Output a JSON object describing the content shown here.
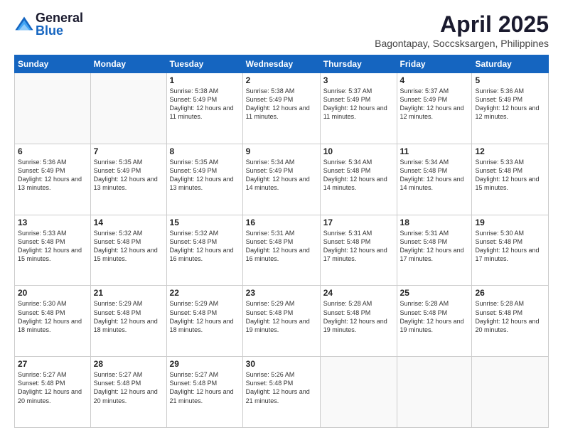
{
  "logo": {
    "general": "General",
    "blue": "Blue"
  },
  "title": "April 2025",
  "subtitle": "Bagontapay, Soccsksargen, Philippines",
  "days_of_week": [
    "Sunday",
    "Monday",
    "Tuesday",
    "Wednesday",
    "Thursday",
    "Friday",
    "Saturday"
  ],
  "weeks": [
    [
      {
        "day": "",
        "info": ""
      },
      {
        "day": "",
        "info": ""
      },
      {
        "day": "1",
        "info": "Sunrise: 5:38 AM\nSunset: 5:49 PM\nDaylight: 12 hours and 11 minutes."
      },
      {
        "day": "2",
        "info": "Sunrise: 5:38 AM\nSunset: 5:49 PM\nDaylight: 12 hours and 11 minutes."
      },
      {
        "day": "3",
        "info": "Sunrise: 5:37 AM\nSunset: 5:49 PM\nDaylight: 12 hours and 11 minutes."
      },
      {
        "day": "4",
        "info": "Sunrise: 5:37 AM\nSunset: 5:49 PM\nDaylight: 12 hours and 12 minutes."
      },
      {
        "day": "5",
        "info": "Sunrise: 5:36 AM\nSunset: 5:49 PM\nDaylight: 12 hours and 12 minutes."
      }
    ],
    [
      {
        "day": "6",
        "info": "Sunrise: 5:36 AM\nSunset: 5:49 PM\nDaylight: 12 hours and 13 minutes."
      },
      {
        "day": "7",
        "info": "Sunrise: 5:35 AM\nSunset: 5:49 PM\nDaylight: 12 hours and 13 minutes."
      },
      {
        "day": "8",
        "info": "Sunrise: 5:35 AM\nSunset: 5:49 PM\nDaylight: 12 hours and 13 minutes."
      },
      {
        "day": "9",
        "info": "Sunrise: 5:34 AM\nSunset: 5:49 PM\nDaylight: 12 hours and 14 minutes."
      },
      {
        "day": "10",
        "info": "Sunrise: 5:34 AM\nSunset: 5:48 PM\nDaylight: 12 hours and 14 minutes."
      },
      {
        "day": "11",
        "info": "Sunrise: 5:34 AM\nSunset: 5:48 PM\nDaylight: 12 hours and 14 minutes."
      },
      {
        "day": "12",
        "info": "Sunrise: 5:33 AM\nSunset: 5:48 PM\nDaylight: 12 hours and 15 minutes."
      }
    ],
    [
      {
        "day": "13",
        "info": "Sunrise: 5:33 AM\nSunset: 5:48 PM\nDaylight: 12 hours and 15 minutes."
      },
      {
        "day": "14",
        "info": "Sunrise: 5:32 AM\nSunset: 5:48 PM\nDaylight: 12 hours and 15 minutes."
      },
      {
        "day": "15",
        "info": "Sunrise: 5:32 AM\nSunset: 5:48 PM\nDaylight: 12 hours and 16 minutes."
      },
      {
        "day": "16",
        "info": "Sunrise: 5:31 AM\nSunset: 5:48 PM\nDaylight: 12 hours and 16 minutes."
      },
      {
        "day": "17",
        "info": "Sunrise: 5:31 AM\nSunset: 5:48 PM\nDaylight: 12 hours and 17 minutes."
      },
      {
        "day": "18",
        "info": "Sunrise: 5:31 AM\nSunset: 5:48 PM\nDaylight: 12 hours and 17 minutes."
      },
      {
        "day": "19",
        "info": "Sunrise: 5:30 AM\nSunset: 5:48 PM\nDaylight: 12 hours and 17 minutes."
      }
    ],
    [
      {
        "day": "20",
        "info": "Sunrise: 5:30 AM\nSunset: 5:48 PM\nDaylight: 12 hours and 18 minutes."
      },
      {
        "day": "21",
        "info": "Sunrise: 5:29 AM\nSunset: 5:48 PM\nDaylight: 12 hours and 18 minutes."
      },
      {
        "day": "22",
        "info": "Sunrise: 5:29 AM\nSunset: 5:48 PM\nDaylight: 12 hours and 18 minutes."
      },
      {
        "day": "23",
        "info": "Sunrise: 5:29 AM\nSunset: 5:48 PM\nDaylight: 12 hours and 19 minutes."
      },
      {
        "day": "24",
        "info": "Sunrise: 5:28 AM\nSunset: 5:48 PM\nDaylight: 12 hours and 19 minutes."
      },
      {
        "day": "25",
        "info": "Sunrise: 5:28 AM\nSunset: 5:48 PM\nDaylight: 12 hours and 19 minutes."
      },
      {
        "day": "26",
        "info": "Sunrise: 5:28 AM\nSunset: 5:48 PM\nDaylight: 12 hours and 20 minutes."
      }
    ],
    [
      {
        "day": "27",
        "info": "Sunrise: 5:27 AM\nSunset: 5:48 PM\nDaylight: 12 hours and 20 minutes."
      },
      {
        "day": "28",
        "info": "Sunrise: 5:27 AM\nSunset: 5:48 PM\nDaylight: 12 hours and 20 minutes."
      },
      {
        "day": "29",
        "info": "Sunrise: 5:27 AM\nSunset: 5:48 PM\nDaylight: 12 hours and 21 minutes."
      },
      {
        "day": "30",
        "info": "Sunrise: 5:26 AM\nSunset: 5:48 PM\nDaylight: 12 hours and 21 minutes."
      },
      {
        "day": "",
        "info": ""
      },
      {
        "day": "",
        "info": ""
      },
      {
        "day": "",
        "info": ""
      }
    ]
  ]
}
